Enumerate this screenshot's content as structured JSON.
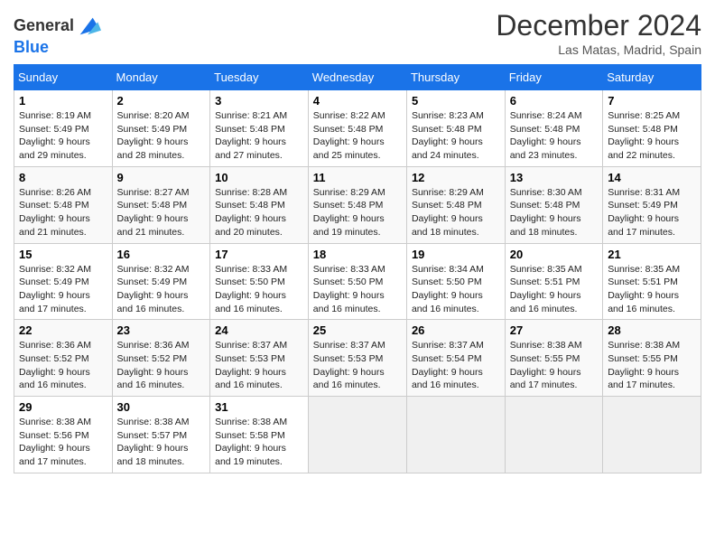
{
  "header": {
    "logo_line1": "General",
    "logo_line2": "Blue",
    "month": "December 2024",
    "location": "Las Matas, Madrid, Spain"
  },
  "weekdays": [
    "Sunday",
    "Monday",
    "Tuesday",
    "Wednesday",
    "Thursday",
    "Friday",
    "Saturday"
  ],
  "weeks": [
    [
      {
        "day": "1",
        "sunrise": "8:19 AM",
        "sunset": "5:49 PM",
        "daylight": "9 hours and 29 minutes."
      },
      {
        "day": "2",
        "sunrise": "8:20 AM",
        "sunset": "5:49 PM",
        "daylight": "9 hours and 28 minutes."
      },
      {
        "day": "3",
        "sunrise": "8:21 AM",
        "sunset": "5:48 PM",
        "daylight": "9 hours and 27 minutes."
      },
      {
        "day": "4",
        "sunrise": "8:22 AM",
        "sunset": "5:48 PM",
        "daylight": "9 hours and 25 minutes."
      },
      {
        "day": "5",
        "sunrise": "8:23 AM",
        "sunset": "5:48 PM",
        "daylight": "9 hours and 24 minutes."
      },
      {
        "day": "6",
        "sunrise": "8:24 AM",
        "sunset": "5:48 PM",
        "daylight": "9 hours and 23 minutes."
      },
      {
        "day": "7",
        "sunrise": "8:25 AM",
        "sunset": "5:48 PM",
        "daylight": "9 hours and 22 minutes."
      }
    ],
    [
      {
        "day": "8",
        "sunrise": "8:26 AM",
        "sunset": "5:48 PM",
        "daylight": "9 hours and 21 minutes."
      },
      {
        "day": "9",
        "sunrise": "8:27 AM",
        "sunset": "5:48 PM",
        "daylight": "9 hours and 21 minutes."
      },
      {
        "day": "10",
        "sunrise": "8:28 AM",
        "sunset": "5:48 PM",
        "daylight": "9 hours and 20 minutes."
      },
      {
        "day": "11",
        "sunrise": "8:29 AM",
        "sunset": "5:48 PM",
        "daylight": "9 hours and 19 minutes."
      },
      {
        "day": "12",
        "sunrise": "8:29 AM",
        "sunset": "5:48 PM",
        "daylight": "9 hours and 18 minutes."
      },
      {
        "day": "13",
        "sunrise": "8:30 AM",
        "sunset": "5:48 PM",
        "daylight": "9 hours and 18 minutes."
      },
      {
        "day": "14",
        "sunrise": "8:31 AM",
        "sunset": "5:49 PM",
        "daylight": "9 hours and 17 minutes."
      }
    ],
    [
      {
        "day": "15",
        "sunrise": "8:32 AM",
        "sunset": "5:49 PM",
        "daylight": "9 hours and 17 minutes."
      },
      {
        "day": "16",
        "sunrise": "8:32 AM",
        "sunset": "5:49 PM",
        "daylight": "9 hours and 16 minutes."
      },
      {
        "day": "17",
        "sunrise": "8:33 AM",
        "sunset": "5:50 PM",
        "daylight": "9 hours and 16 minutes."
      },
      {
        "day": "18",
        "sunrise": "8:33 AM",
        "sunset": "5:50 PM",
        "daylight": "9 hours and 16 minutes."
      },
      {
        "day": "19",
        "sunrise": "8:34 AM",
        "sunset": "5:50 PM",
        "daylight": "9 hours and 16 minutes."
      },
      {
        "day": "20",
        "sunrise": "8:35 AM",
        "sunset": "5:51 PM",
        "daylight": "9 hours and 16 minutes."
      },
      {
        "day": "21",
        "sunrise": "8:35 AM",
        "sunset": "5:51 PM",
        "daylight": "9 hours and 16 minutes."
      }
    ],
    [
      {
        "day": "22",
        "sunrise": "8:36 AM",
        "sunset": "5:52 PM",
        "daylight": "9 hours and 16 minutes."
      },
      {
        "day": "23",
        "sunrise": "8:36 AM",
        "sunset": "5:52 PM",
        "daylight": "9 hours and 16 minutes."
      },
      {
        "day": "24",
        "sunrise": "8:37 AM",
        "sunset": "5:53 PM",
        "daylight": "9 hours and 16 minutes."
      },
      {
        "day": "25",
        "sunrise": "8:37 AM",
        "sunset": "5:53 PM",
        "daylight": "9 hours and 16 minutes."
      },
      {
        "day": "26",
        "sunrise": "8:37 AM",
        "sunset": "5:54 PM",
        "daylight": "9 hours and 16 minutes."
      },
      {
        "day": "27",
        "sunrise": "8:38 AM",
        "sunset": "5:55 PM",
        "daylight": "9 hours and 17 minutes."
      },
      {
        "day": "28",
        "sunrise": "8:38 AM",
        "sunset": "5:55 PM",
        "daylight": "9 hours and 17 minutes."
      }
    ],
    [
      {
        "day": "29",
        "sunrise": "8:38 AM",
        "sunset": "5:56 PM",
        "daylight": "9 hours and 17 minutes."
      },
      {
        "day": "30",
        "sunrise": "8:38 AM",
        "sunset": "5:57 PM",
        "daylight": "9 hours and 18 minutes."
      },
      {
        "day": "31",
        "sunrise": "8:38 AM",
        "sunset": "5:58 PM",
        "daylight": "9 hours and 19 minutes."
      },
      null,
      null,
      null,
      null
    ]
  ]
}
